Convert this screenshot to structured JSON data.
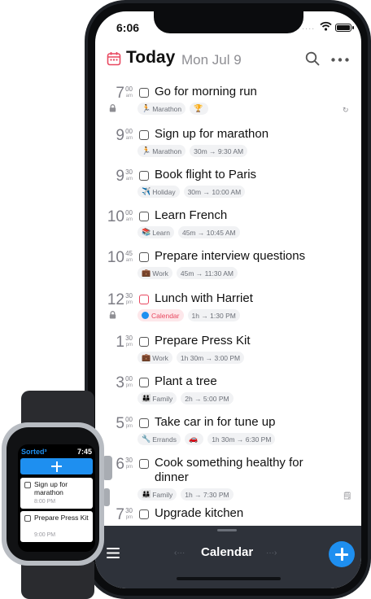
{
  "phone": {
    "status_time": "6:06",
    "status_dots": "....",
    "title": "Today",
    "date": "Mon Jul 9"
  },
  "tasks": [
    {
      "hour": "7",
      "mins": "00",
      "ampm": "am",
      "title": "Go for morning run",
      "locked": true,
      "right_icon": "↻",
      "chips": [
        {
          "emoji": "🏃",
          "text": "Marathon"
        },
        {
          "emoji": "🏆",
          "text": ""
        }
      ]
    },
    {
      "hour": "9",
      "mins": "00",
      "ampm": "am",
      "title": "Sign up for marathon",
      "chips": [
        {
          "emoji": "🏃",
          "text": "Marathon"
        },
        {
          "emoji": "",
          "text": "30m → 9:30 AM"
        }
      ]
    },
    {
      "hour": "9",
      "mins": "30",
      "ampm": "am",
      "title": "Book flight to Paris",
      "chips": [
        {
          "emoji": "✈️",
          "text": "Holiday"
        },
        {
          "emoji": "",
          "text": "30m → 10:00 AM"
        }
      ]
    },
    {
      "hour": "10",
      "mins": "00",
      "ampm": "am",
      "title": "Learn French",
      "chips": [
        {
          "emoji": "📚",
          "text": "Learn"
        },
        {
          "emoji": "",
          "text": "45m → 10:45 AM"
        }
      ]
    },
    {
      "hour": "10",
      "mins": "45",
      "ampm": "am",
      "title": "Prepare interview questions",
      "chips": [
        {
          "emoji": "💼",
          "text": "Work"
        },
        {
          "emoji": "",
          "text": "45m → 11:30 AM"
        }
      ]
    },
    {
      "hour": "12",
      "mins": "30",
      "ampm": "pm",
      "title": "Lunch with Harriet",
      "locked": true,
      "calendar": true,
      "chips": [
        {
          "emoji": "",
          "text": "Calendar",
          "calendar": true
        },
        {
          "emoji": "",
          "text": "1h → 1:30 PM"
        }
      ]
    },
    {
      "hour": "1",
      "mins": "30",
      "ampm": "pm",
      "title": "Prepare Press Kit",
      "chips": [
        {
          "emoji": "💼",
          "text": "Work"
        },
        {
          "emoji": "",
          "text": "1h 30m → 3:00 PM"
        }
      ]
    },
    {
      "hour": "3",
      "mins": "00",
      "ampm": "pm",
      "title": "Plant a tree",
      "chips": [
        {
          "emoji": "👪",
          "text": "Family"
        },
        {
          "emoji": "",
          "text": "2h → 5:00 PM"
        }
      ]
    },
    {
      "hour": "5",
      "mins": "00",
      "ampm": "pm",
      "title": "Take car in for tune up",
      "chips": [
        {
          "emoji": "🔧",
          "text": "Errands"
        },
        {
          "emoji": "🚗",
          "text": ""
        },
        {
          "emoji": "",
          "text": "1h 30m → 6:30 PM"
        }
      ]
    },
    {
      "hour": "6",
      "mins": "30",
      "ampm": "pm",
      "title": "Cook something healthy for dinner",
      "wrap": true,
      "right_icon": "🗒",
      "chips": [
        {
          "emoji": "👪",
          "text": "Family"
        },
        {
          "emoji": "",
          "text": "1h → 7:30 PM"
        }
      ]
    },
    {
      "hour": "7",
      "mins": "30",
      "ampm": "pm",
      "title": "Upgrade kitchen",
      "chips": []
    }
  ],
  "bottom_bar": {
    "left_arrow": "‹···",
    "label": "Calendar",
    "right_arrow": "···›"
  },
  "watch": {
    "brand": "Sorted³",
    "time": "7:45",
    "items": [
      {
        "title": "Sign up for marathon",
        "time": "8:00 PM"
      },
      {
        "title": "Prepare Press Kit",
        "time": "9:00 PM"
      }
    ]
  },
  "colors": {
    "accent": "#1e8ff0",
    "calendar_red": "#e8475f",
    "bar": "#2e323a"
  }
}
